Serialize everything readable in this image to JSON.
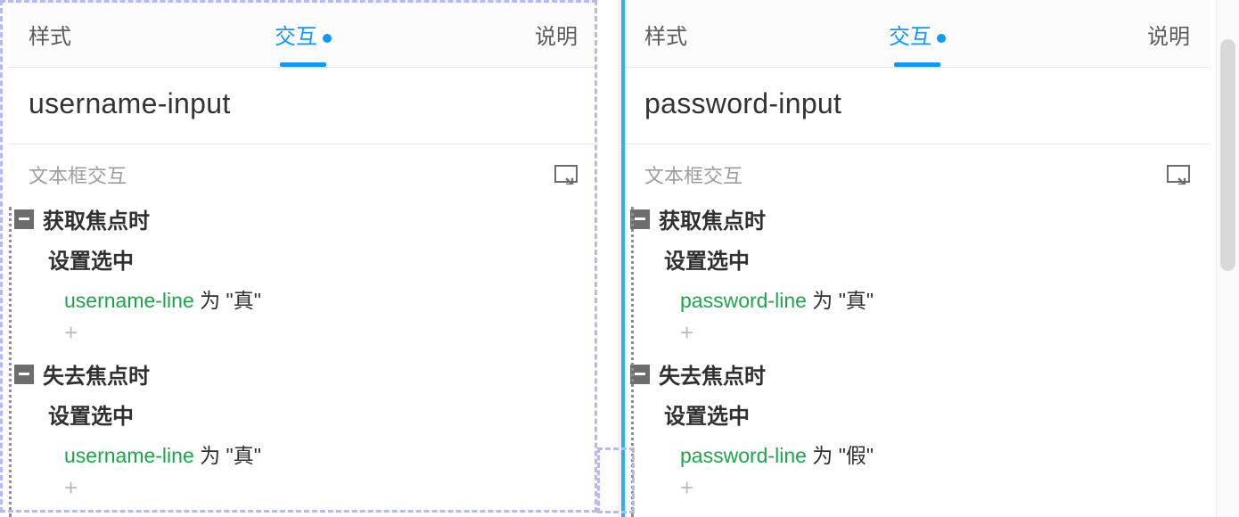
{
  "tabs": {
    "style": "样式",
    "interact": "交互",
    "desc": "说明"
  },
  "section_label": "文本框交互",
  "action_set_selected": "设置选中",
  "to_word": "为",
  "true_q": "\"真\"",
  "false_q": "\"假\"",
  "plus": "+",
  "left": {
    "name": "username-input",
    "var": "username-line",
    "t1": "获取焦点时",
    "t2": "失去焦点时",
    "v1": "\"真\"",
    "v2": "\"真\""
  },
  "right": {
    "name": "password-input",
    "var": "password-line",
    "t1": "获取焦点时",
    "t2": "失去焦点时",
    "v1": "\"真\"",
    "v2": "\"假\""
  }
}
